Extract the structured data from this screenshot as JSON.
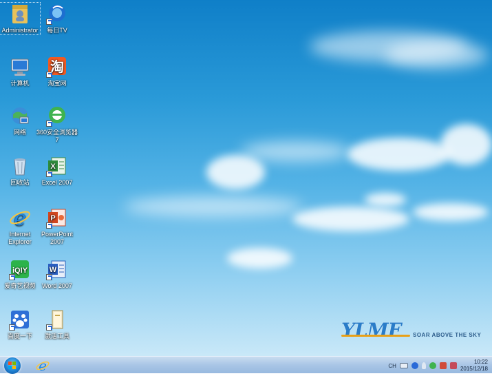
{
  "desktop": {
    "icons": [
      {
        "label": "Administrator",
        "icon": "user-folder-icon"
      },
      {
        "label": "每日TV",
        "icon": "tv-app-icon"
      },
      {
        "label": "计算机",
        "icon": "computer-icon"
      },
      {
        "label": "淘宝网",
        "icon": "taobao-icon"
      },
      {
        "label": "网络",
        "icon": "network-icon"
      },
      {
        "label": "360安全浏览器7",
        "icon": "360-browser-icon"
      },
      {
        "label": "回收站",
        "icon": "recycle-bin-icon"
      },
      {
        "label": "Excel 2007",
        "icon": "excel-icon"
      },
      {
        "label": "Internet Explorer",
        "icon": "internet-explorer-icon"
      },
      {
        "label": "PowerPoint 2007",
        "icon": "powerpoint-icon"
      },
      {
        "label": "爱奇艺视频",
        "icon": "iqiyi-icon"
      },
      {
        "label": "Word 2007",
        "icon": "word-icon"
      },
      {
        "label": "百度一下",
        "icon": "baidu-icon"
      },
      {
        "label": "激活工具",
        "icon": "activation-tool-icon"
      }
    ],
    "logo": {
      "text": "YLMF",
      "tagline": "SOAR ABOVE THE SKY"
    }
  },
  "taskbar": {
    "pinned": [
      {
        "icon": "internet-explorer-icon"
      }
    ],
    "tray": {
      "input_label": "CH",
      "time": "10:22",
      "date": "2015/12/18"
    }
  },
  "colors": {
    "sky_top": "#0f7fc8",
    "sky_bottom": "#c9e8f8",
    "taskbar": "#a9c6e6",
    "logo_blue": "#2a7cc8",
    "logo_orange": "#e8a018"
  }
}
